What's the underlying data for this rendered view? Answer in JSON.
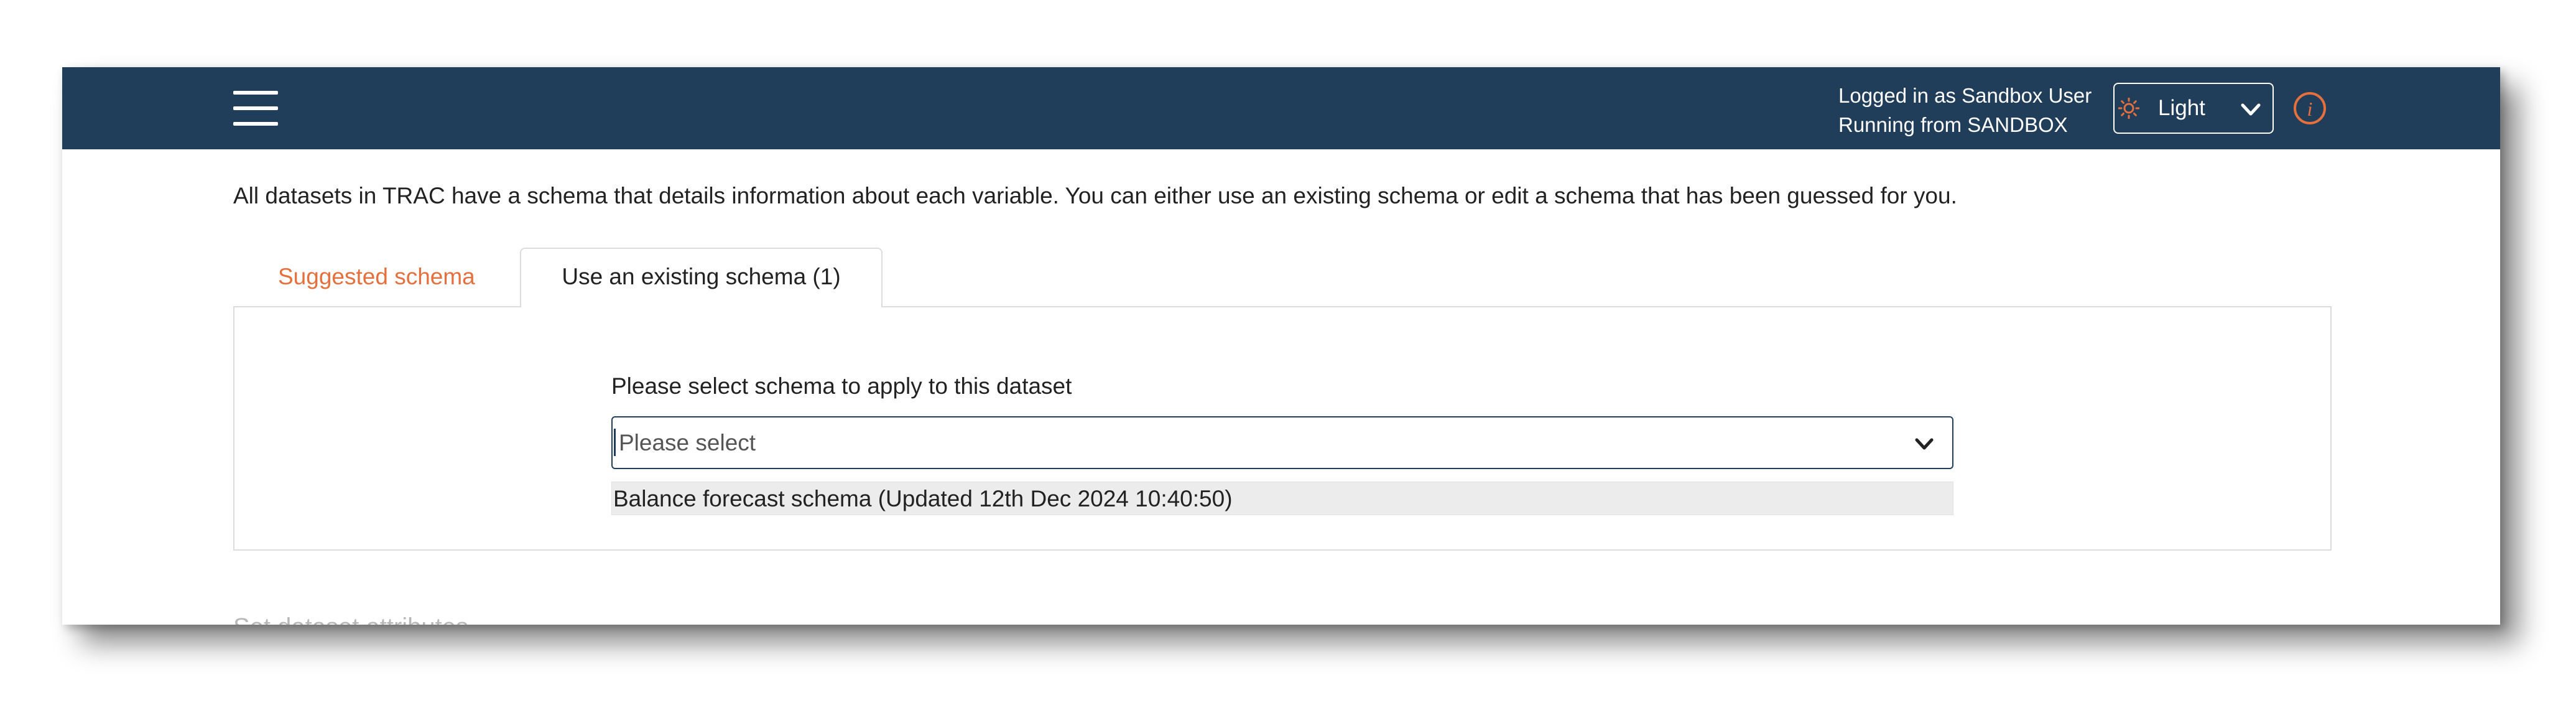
{
  "header": {
    "logged_in_text": "Logged in as Sandbox User",
    "running_from_text": "Running from SANDBOX",
    "theme": {
      "label": "Light",
      "icon": "sun-icon",
      "icon_color": "#e3703d"
    },
    "menu_icon": "hamburger-menu-icon",
    "info_icon": "info-icon",
    "bg_color": "#203d5a",
    "accent_color": "#e3703d"
  },
  "main": {
    "intro_text": "All datasets in TRAC have a schema that details information about each variable. You can either use an existing schema or edit a schema that has been guessed for you.",
    "tabs": [
      {
        "label": "Suggested schema",
        "active": false
      },
      {
        "label": "Use an existing schema (1)",
        "active": true
      }
    ],
    "schema_select": {
      "label": "Please select schema to apply to this dataset",
      "placeholder": "Please select",
      "options": [
        {
          "label": "Balance forecast schema (Updated 12th Dec 2024 10:40:50)"
        }
      ]
    },
    "next_section_heading": "Set dataset attributes"
  }
}
